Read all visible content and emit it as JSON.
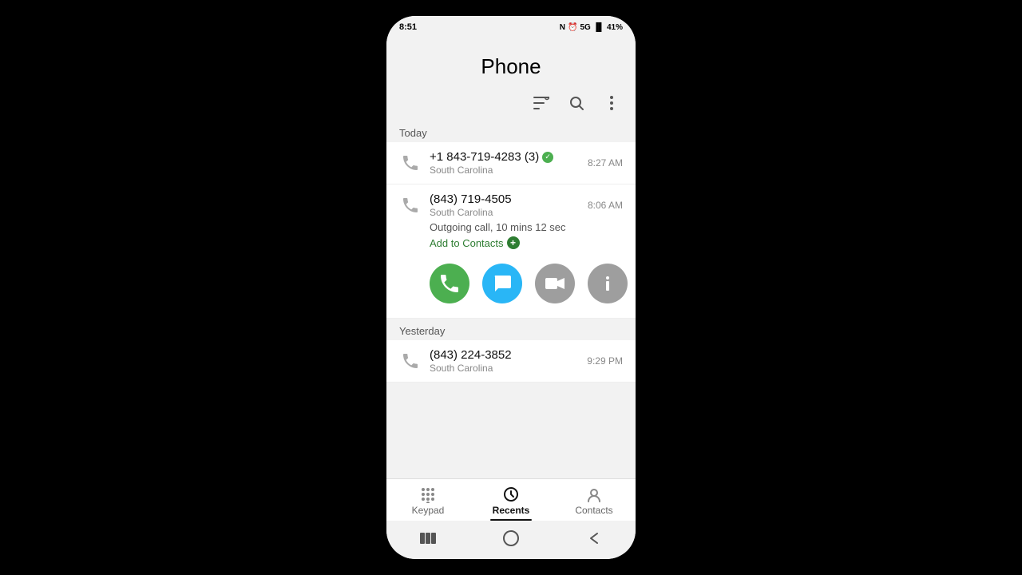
{
  "status_bar": {
    "time": "8:51",
    "battery": "41%",
    "network": "5G"
  },
  "app": {
    "title": "Phone"
  },
  "toolbar": {
    "filter_icon": "≡",
    "search_icon": "🔍",
    "more_icon": "⋮"
  },
  "sections": [
    {
      "label": "Today",
      "calls": [
        {
          "id": "call1",
          "number": "+1 843-719-4283 (3)",
          "verified": true,
          "location": "South Carolina",
          "time": "8:27 AM",
          "expanded": false
        },
        {
          "id": "call2",
          "number": "(843) 719-4505",
          "verified": false,
          "location": "South Carolina",
          "time": "8:06 AM",
          "expanded": true,
          "detail": "Outgoing call, 10 mins 12 sec",
          "add_contacts_label": "Add to Contacts"
        }
      ]
    },
    {
      "label": "Yesterday",
      "calls": [
        {
          "id": "call3",
          "number": "(843) 224-3852",
          "verified": false,
          "location": "South Carolina",
          "time": "9:29 PM",
          "expanded": false
        }
      ]
    }
  ],
  "action_buttons": [
    {
      "id": "call-action",
      "type": "call",
      "label": "Call"
    },
    {
      "id": "message-action",
      "type": "message",
      "label": "Message"
    },
    {
      "id": "video-action",
      "type": "video",
      "label": "Video"
    },
    {
      "id": "info-action",
      "type": "info",
      "label": "Info"
    }
  ],
  "bottom_nav": [
    {
      "id": "keypad",
      "label": "Keypad",
      "active": false
    },
    {
      "id": "recents",
      "label": "Recents",
      "active": true
    },
    {
      "id": "contacts",
      "label": "Contacts",
      "active": false
    }
  ],
  "colors": {
    "accent_green": "#4CAF50",
    "accent_blue": "#29b6f6",
    "accent_gray": "#9e9e9e",
    "text_dark": "#111111",
    "text_mid": "#555555",
    "text_light": "#888888",
    "add_contacts_green": "#2e7d32"
  }
}
